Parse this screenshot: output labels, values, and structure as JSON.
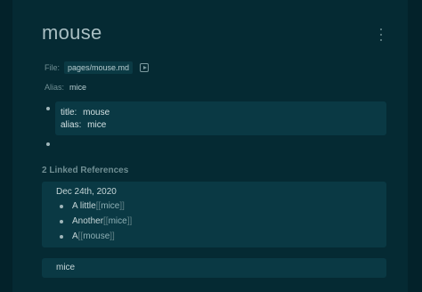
{
  "page": {
    "title": "mouse"
  },
  "properties": {
    "file_label": "File:",
    "file_path": "pages/mouse.md",
    "alias_label": "Alias:",
    "alias_value": "mice"
  },
  "block": {
    "title_key": "title:",
    "title_value": "mouse",
    "alias_key": "alias:",
    "alias_value": "mice"
  },
  "linked_references": {
    "header": "2 Linked References",
    "group": {
      "date": "Dec 24th, 2020",
      "items": [
        {
          "text": "A little ",
          "link": "mice"
        },
        {
          "text": "Another ",
          "link": "mice"
        },
        {
          "text": "A ",
          "link": "mouse"
        }
      ]
    },
    "second": {
      "title": "mice"
    }
  },
  "icons": {
    "more": "more-vertical-icon",
    "open_file": "open-file-icon",
    "bullet": "bullet-icon"
  }
}
